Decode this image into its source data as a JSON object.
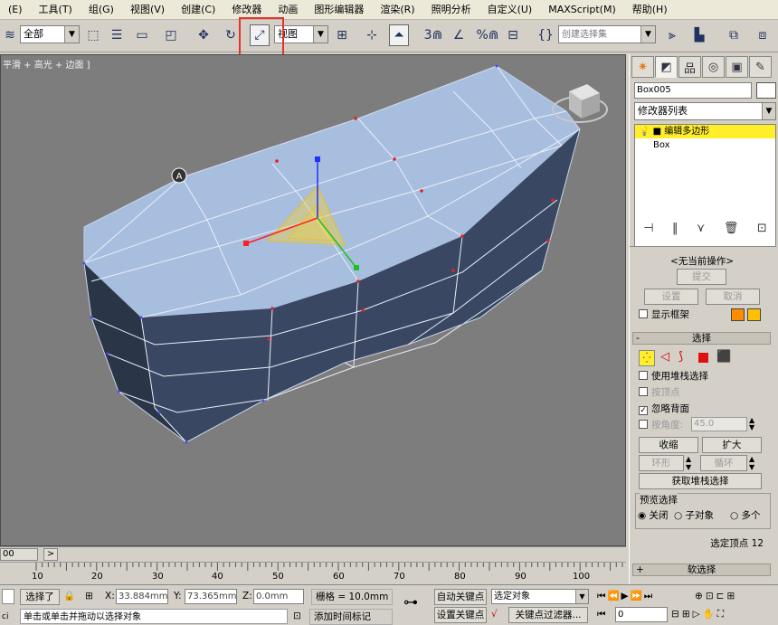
{
  "menu": [
    "(E)",
    "工具(T)",
    "组(G)",
    "视图(V)",
    "创建(C)",
    "修改器",
    "动画",
    "图形编辑器",
    "渲染(R)",
    "照明分析",
    "自定义(U)",
    "MAXScript(M)",
    "帮助(H)"
  ],
  "toolbar": {
    "selection_filter": "全部",
    "ref_coord": "视图",
    "named_selection": "创建选择集",
    "snap_label": "3",
    "angle_snap_label": "",
    "percent_snap_label": "%"
  },
  "viewport": {
    "label": "平滑 + 高光 + 边面 ]"
  },
  "panel": {
    "object_name": "Box005",
    "modifier_list": "修改器列表",
    "stack": [
      "编辑多边形",
      "Box"
    ],
    "no_current_op": "<无当前操作>",
    "commit": "提交",
    "settings": "设置",
    "cancel": "取消",
    "show_cage": "显示框架",
    "selection_header": "选择",
    "use_stack_selection": "使用堆栈选择",
    "by_vertex": "按顶点",
    "ignore_backfacing": "忽略背面",
    "by_angle": "按角度:",
    "angle_value": "45.0",
    "shrink": "收缩",
    "grow": "扩大",
    "ring": "环形",
    "loop": "循环",
    "get_stack_selection": "获取堆栈选择",
    "preview_selection": "预览选择",
    "preview_off": "关闭",
    "preview_subobj": "子对象",
    "preview_multi": "多个",
    "selected_vertices": "选定顶点 12",
    "soft_selection": "软选择",
    "rollout_minus": "-",
    "rollout_plus": "+"
  },
  "timeline": {
    "frame_display": "00",
    "next_arrow": ">",
    "ticks": [
      "10",
      "20",
      "30",
      "40",
      "50",
      "60",
      "70",
      "80",
      "90",
      "100"
    ]
  },
  "status": {
    "selected": "选择了",
    "x_label": "X:",
    "x_value": "33.884mm",
    "y_label": "Y:",
    "y_value": "73.365mm",
    "z_label": "Z:",
    "z_value": "0.0mm",
    "grid": "栅格 = 10.0mm",
    "auto_key": "自动关键点",
    "selected_object": "选定对象",
    "set_key": "设置关键点",
    "key_filters": "关键点过滤器...",
    "frame_value": "0",
    "prompt": "单击或单击并拖动以选择对象",
    "add_time_tag": "添加时间标记",
    "max_listener": "ci"
  },
  "colors": {
    "viewport_bg": "#7d7d7d",
    "mesh_top": "#a8bedf",
    "mesh_side": "#2a3548",
    "highlight": "#e8312a",
    "active_modifier": "#ffee2a",
    "cage_color_1": "#ff8c00",
    "cage_color_2": "#ffc000"
  }
}
